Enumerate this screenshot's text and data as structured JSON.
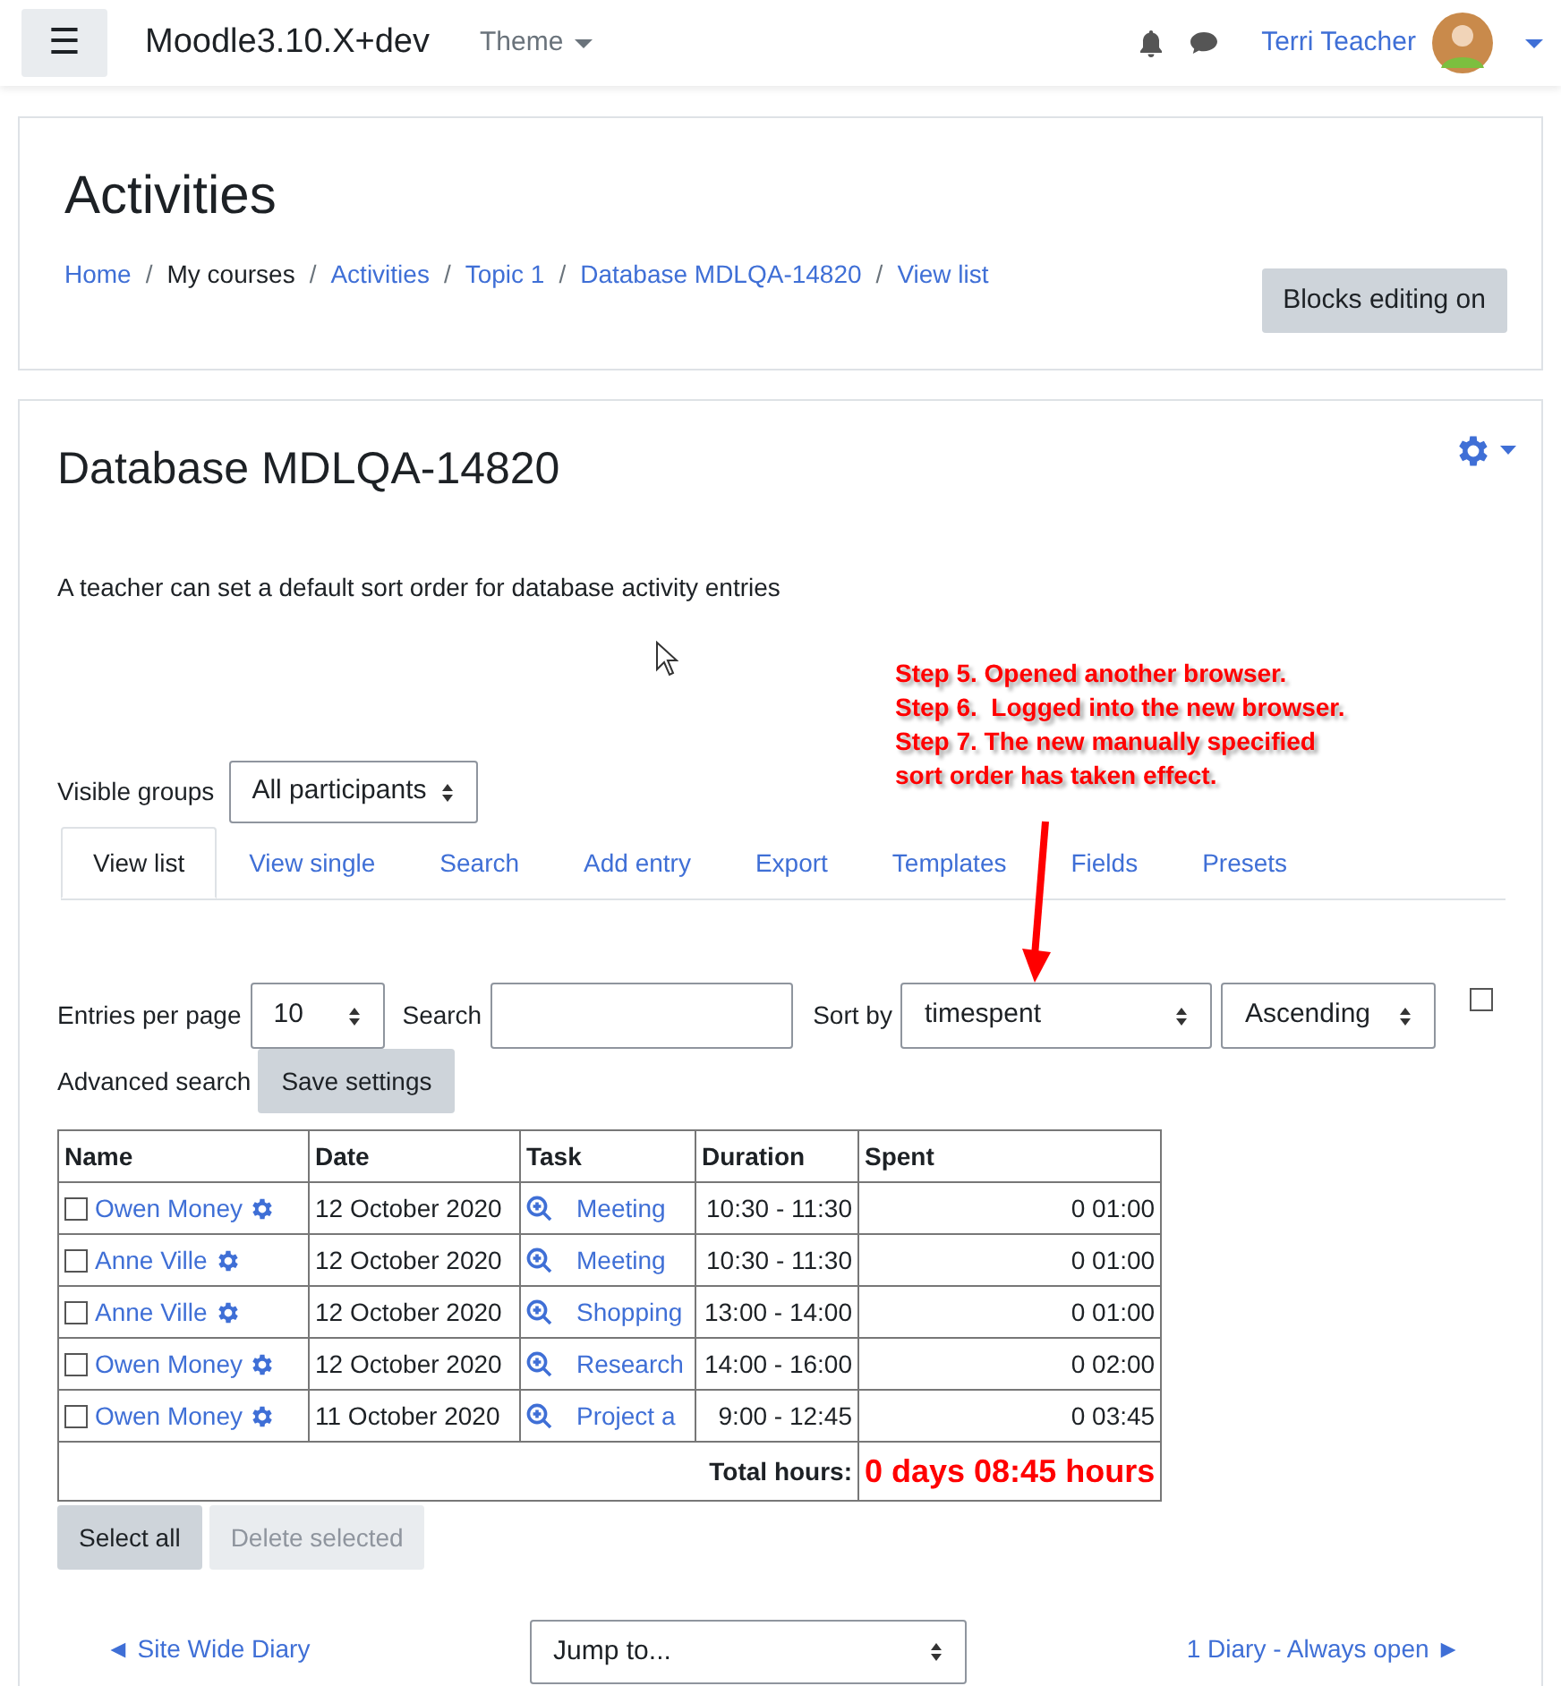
{
  "navbar": {
    "menu_icon": "☰",
    "site_name": "Moodle3.10.X+dev",
    "theme_menu": "Theme",
    "user_name": "Terri Teacher"
  },
  "header": {
    "title": "Activities",
    "separator": "/",
    "breadcrumbs": [
      {
        "label": "Home",
        "link": true
      },
      {
        "label": "My courses",
        "link": false
      },
      {
        "label": "Activities",
        "link": true
      },
      {
        "label": "Topic 1",
        "link": true
      },
      {
        "label": "Database MDLQA-14820",
        "link": true
      },
      {
        "label": "View list",
        "link": true
      }
    ],
    "editing_button": "Blocks editing on"
  },
  "activity": {
    "title": "Database MDLQA-14820",
    "description": "A teacher can set a default sort order for database activity entries"
  },
  "annotation": {
    "lines": [
      "Step 5. Opened another browser.",
      "Step 6.  Logged into the new browser.",
      "Step 7. The new manually specified",
      "sort order has taken effect."
    ]
  },
  "groups": {
    "label": "Visible groups",
    "value": "All participants"
  },
  "tabs": [
    {
      "label": "View list",
      "selected": true
    },
    {
      "label": "View single",
      "selected": false
    },
    {
      "label": "Search",
      "selected": false
    },
    {
      "label": "Add entry",
      "selected": false
    },
    {
      "label": "Export",
      "selected": false
    },
    {
      "label": "Templates",
      "selected": false
    },
    {
      "label": "Fields",
      "selected": false
    },
    {
      "label": "Presets",
      "selected": false
    }
  ],
  "options": {
    "per_page_label": "Entries per page",
    "per_page": "10",
    "search_label": "Search",
    "sort_label": "Sort by",
    "sort_field": "timespent",
    "sort_order": "Ascending",
    "advanced_checked": false,
    "advanced_label": "Advanced search",
    "save_button": "Save settings"
  },
  "table": {
    "columns": [
      "Name",
      "Date",
      "Task",
      "Duration",
      "Spent"
    ],
    "rows": [
      {
        "checked": false,
        "name": "Owen Money",
        "date": "12 October 2020",
        "task": "Meeting",
        "duration": "10:30 - 11:30",
        "spent": "0 01:00"
      },
      {
        "checked": false,
        "name": "Anne Ville",
        "date": "12 October 2020",
        "task": "Meeting",
        "duration": "10:30 - 11:30",
        "spent": "0 01:00"
      },
      {
        "checked": false,
        "name": "Anne Ville",
        "date": "12 October 2020",
        "task": "Shopping",
        "duration": "13:00 - 14:00",
        "spent": "0 01:00"
      },
      {
        "checked": false,
        "name": "Owen Money",
        "date": "12 October 2020",
        "task": "Research",
        "duration": "14:00 - 16:00",
        "spent": "0 02:00"
      },
      {
        "checked": false,
        "name": "Owen Money",
        "date": "11 October 2020",
        "task": "Project a",
        "duration": "9:00 - 12:45",
        "spent": "0 03:45"
      }
    ],
    "total_label": "Total hours:",
    "total_value": "0 days 08:45 hours"
  },
  "actions": [
    {
      "label": "Select all",
      "disabled": false
    },
    {
      "label": "Delete selected",
      "disabled": true
    }
  ],
  "footer": {
    "prev_link": "◄ Site Wide Diary",
    "jump": "Jump to...",
    "next_link": "1 Diary - Always open ►"
  }
}
